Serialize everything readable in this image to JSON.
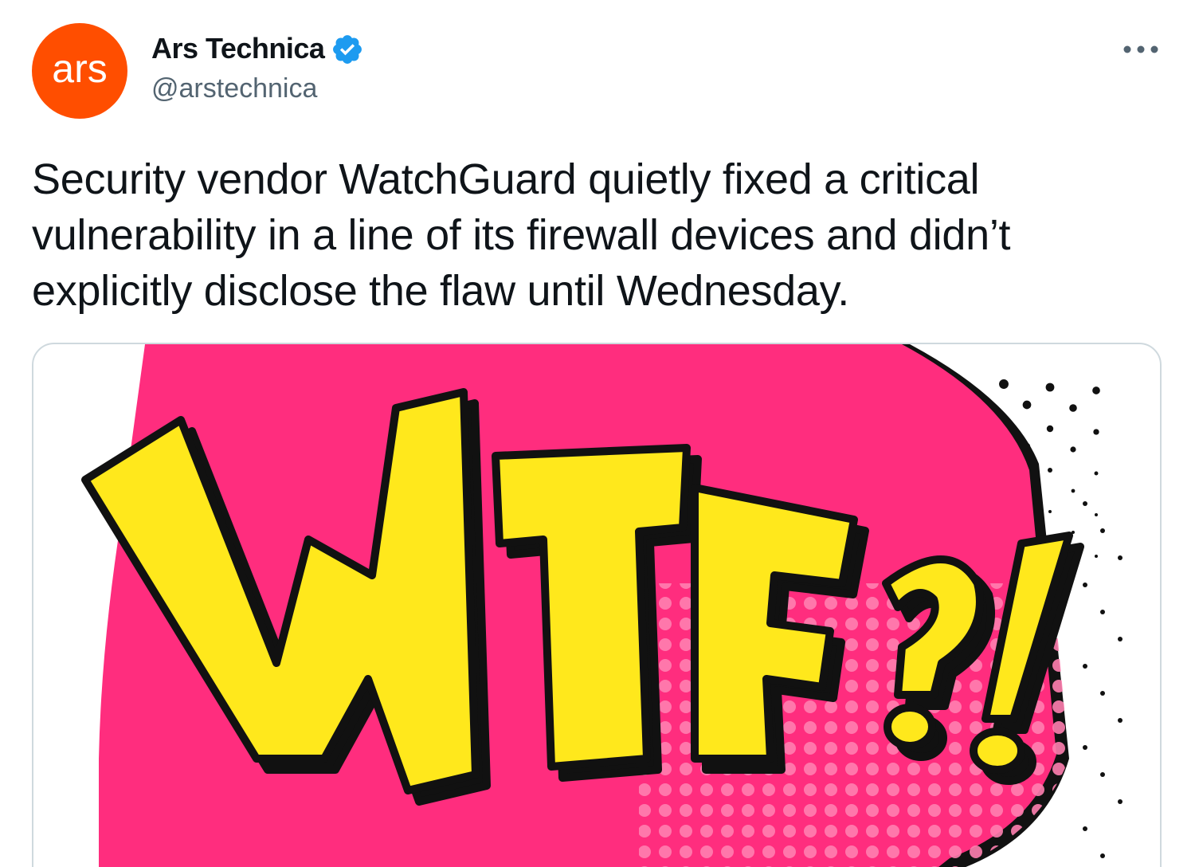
{
  "author": {
    "avatar_text": "ars",
    "display_name": "Ars Technica",
    "handle": "@arstechnica",
    "verified": true
  },
  "tweet": {
    "text": "Security vendor WatchGuard quietly fixed a critical\nvulnerability in a line of its firewall devices and didn’t\nexplicitly disclose the flaw until Wednesday."
  },
  "media": {
    "comic_text": "WTF?!",
    "colors": {
      "bubble": "#ff2d7e",
      "letters": "#ffe81c",
      "outline": "#111111",
      "dots": "#ff7fb0"
    }
  },
  "icons": {
    "verified": "verified-badge-icon",
    "more": "more-options-icon"
  },
  "colors": {
    "avatar_bg": "#ff4e00",
    "verified": "#1d9bf0",
    "text": "#0f1419",
    "secondary": "#536471",
    "border": "#cfd9de"
  }
}
